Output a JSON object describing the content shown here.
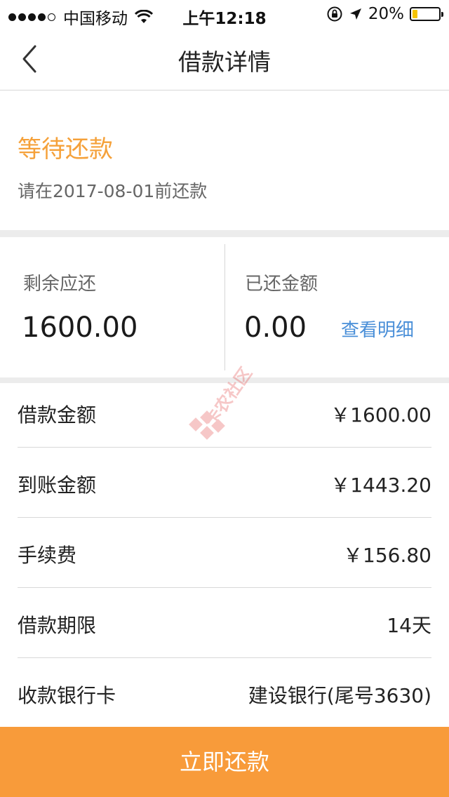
{
  "statusbar": {
    "carrier": "中国移动",
    "time": "上午12:18",
    "battery": "20%",
    "battery_level": 0.2
  },
  "nav": {
    "title": "借款详情"
  },
  "status": {
    "title": "等待还款",
    "subtitle": "请在2017-08-01前还款"
  },
  "amounts": {
    "remaining_label": "剩余应还",
    "remaining_value": "1600.00",
    "paid_label": "已还金额",
    "paid_value": "0.00",
    "detail_link": "查看明细"
  },
  "details": [
    {
      "label": "借款金额",
      "value": "￥1600.00"
    },
    {
      "label": "到账金额",
      "value": "￥1443.20"
    },
    {
      "label": "手续费",
      "value": "￥156.80"
    },
    {
      "label": "借款期限",
      "value": "14天"
    },
    {
      "label": "收款银行卡",
      "value": "建设银行(尾号3630)"
    }
  ],
  "watermark": {
    "text": "卡农社区"
  },
  "actions": {
    "repay_label": "立即还款"
  },
  "colors": {
    "accent": "#f89b3a",
    "status_orange": "#f5a13a",
    "link_blue": "#4a8fd8"
  }
}
